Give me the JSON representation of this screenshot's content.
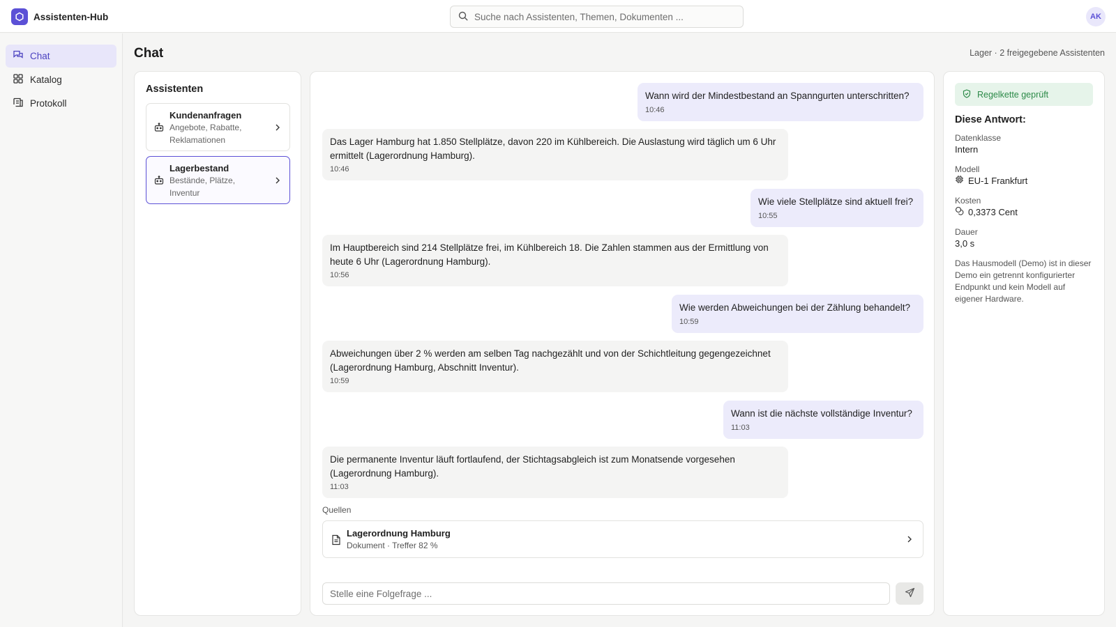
{
  "app": {
    "name": "Assistenten-Hub",
    "avatar": "AK"
  },
  "search": {
    "placeholder": "Suche nach Assistenten, Themen, Dokumenten ..."
  },
  "sidebar": {
    "items": [
      {
        "label": "Chat",
        "icon": "chat-icon",
        "active": true
      },
      {
        "label": "Katalog",
        "icon": "grid-icon",
        "active": false
      },
      {
        "label": "Protokoll",
        "icon": "log-icon",
        "active": false
      }
    ]
  },
  "page": {
    "title": "Chat",
    "meta": "Lager · 2 freigegebene Assistenten"
  },
  "assistants": {
    "heading": "Assistenten",
    "items": [
      {
        "name": "Kundenanfragen",
        "desc": "Angebote, Rabatte, Reklamationen",
        "active": false
      },
      {
        "name": "Lagerbestand",
        "desc": "Bestände, Plätze, Inventur",
        "active": true
      }
    ]
  },
  "chat": {
    "messages": [
      {
        "role": "user",
        "text": "Wann wird der Mindestbestand an Spanngurten unterschritten?",
        "time": "10:46"
      },
      {
        "role": "bot",
        "text": "Das Lager Hamburg hat 1.850 Stellplätze, davon 220 im Kühlbereich. Die Auslastung wird täglich um 6 Uhr ermittelt (Lagerordnung Hamburg).",
        "time": "10:46"
      },
      {
        "role": "user",
        "text": "Wie viele Stellplätze sind aktuell frei?",
        "time": "10:55"
      },
      {
        "role": "bot",
        "text": "Im Hauptbereich sind 214 Stellplätze frei, im Kühlbereich 18. Die Zahlen stammen aus der Ermittlung von heute 6 Uhr (Lagerordnung Hamburg).",
        "time": "10:56"
      },
      {
        "role": "user",
        "text": "Wie werden Abweichungen bei der Zählung behandelt?",
        "time": "10:59"
      },
      {
        "role": "bot",
        "text": "Abweichungen über 2 % werden am selben Tag nachgezählt und von der Schichtleitung gegengezeichnet (Lagerordnung Hamburg, Abschnitt Inventur).",
        "time": "10:59"
      },
      {
        "role": "user",
        "text": "Wann ist die nächste vollständige Inventur?",
        "time": "11:03"
      },
      {
        "role": "bot",
        "text": "Die permanente Inventur läuft fortlaufend, der Stichtagsabgleich ist zum Monatsende vorgesehen (Lagerordnung Hamburg).",
        "time": "11:03"
      }
    ],
    "sources_label": "Quellen",
    "source": {
      "title": "Lagerordnung Hamburg",
      "subtitle": "Dokument · Treffer 82 %"
    },
    "composer_placeholder": "Stelle eine Folgefrage ..."
  },
  "details": {
    "badge": "Regelkette geprüft",
    "heading": "Diese Antwort:",
    "data_class_label": "Datenklasse",
    "data_class": "Intern",
    "model_label": "Modell",
    "model": "EU-1 Frankfurt",
    "cost_label": "Kosten",
    "cost": "0,3373 Cent",
    "duration_label": "Dauer",
    "duration": "3,0 s",
    "note": "Das Hausmodell (Demo) ist in dieser Demo ein getrennt konfigurierter Endpunkt und kein Modell auf eigener Hardware."
  },
  "colors": {
    "accent": "#5b50d6",
    "user_bubble": "#ecebfb",
    "bot_bubble": "#f4f4f3",
    "success": "#2c8a48"
  }
}
